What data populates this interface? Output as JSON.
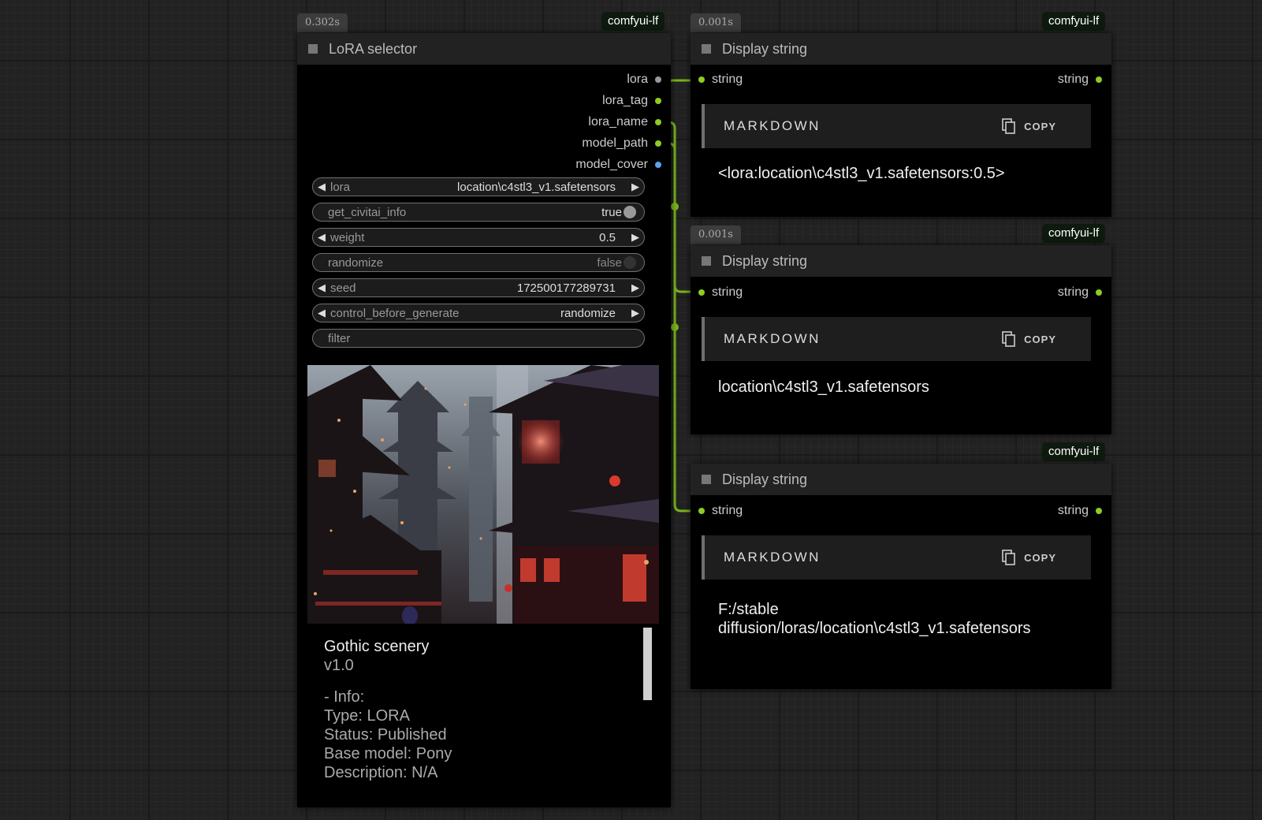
{
  "colors": {
    "link": "#79b51b",
    "dot_gray": "#999999",
    "dot_green": "#8ecc22",
    "dot_blue": "#55a5f0"
  },
  "lora_node": {
    "time": "0.302s",
    "tag": "comfyui-lf",
    "title": "LoRA selector",
    "outputs": [
      "lora",
      "lora_tag",
      "lora_name",
      "model_path",
      "model_cover"
    ],
    "widgets": {
      "lora": {
        "label": "lora",
        "value": "location\\c4stl3_v1.safetensors"
      },
      "civitai": {
        "label": "get_civitai_info",
        "value": "true"
      },
      "weight": {
        "label": "weight",
        "value": "0.5"
      },
      "randomize": {
        "label": "randomize",
        "value": "false"
      },
      "seed": {
        "label": "seed",
        "value": "172500177289731"
      },
      "control": {
        "label": "control_before_generate",
        "value": "randomize"
      },
      "filter": {
        "placeholder": "filter"
      }
    },
    "info": {
      "title": "Gothic scenery",
      "version": "v1.0",
      "heading": "- Info:",
      "type": "Type: LORA",
      "status": "Status: Published",
      "base": "Base model: Pony",
      "description": "Description: N/A"
    }
  },
  "display_nodes": [
    {
      "time": "0.001s",
      "tag": "comfyui-lf",
      "title": "Display string",
      "in_label": "string",
      "out_label": "string",
      "md_label": "MARKDOWN",
      "copy_label": "COPY",
      "text": "<lora:location\\c4stl3_v1.safetensors:0.5>"
    },
    {
      "time": "0.001s",
      "tag": "comfyui-lf",
      "title": "Display string",
      "in_label": "string",
      "out_label": "string",
      "md_label": "MARKDOWN",
      "copy_label": "COPY",
      "text": "location\\c4stl3_v1.safetensors"
    },
    {
      "tag": "comfyui-lf",
      "title": "Display string",
      "in_label": "string",
      "out_label": "string",
      "md_label": "MARKDOWN",
      "copy_label": "COPY",
      "text_line1": "F:/stable",
      "text_line2": "diffusion/loras/location\\c4stl3_v1.safetensors"
    }
  ]
}
